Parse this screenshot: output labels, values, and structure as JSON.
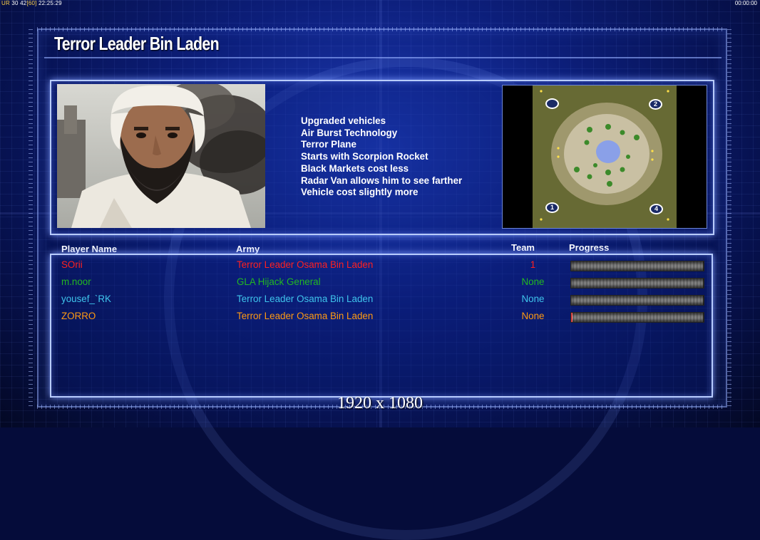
{
  "hud": {
    "left_prefix": "UR",
    "left_stats": "30 42",
    "left_fps": "[60]",
    "left_clock": "22:25:29",
    "right_timer": "00:00:00"
  },
  "title": "Terror Leader Bin Laden",
  "features": [
    "Upgraded vehicles",
    "Air Burst Technology",
    "Terror Plane",
    "Starts with Scorpion Rocket",
    "Black Markets cost less",
    "Radar Van allows him to see farther",
    "Vehicle cost slightly more"
  ],
  "minimap": {
    "start_positions": [
      "",
      "2",
      "1",
      "4"
    ]
  },
  "columns": {
    "player": "Player Name",
    "army": "Army",
    "team": "Team",
    "progress": "Progress"
  },
  "players": [
    {
      "name": "SOrii",
      "army": "Terror Leader Osama Bin Laden",
      "team": "1",
      "color": "#ff2020",
      "progress": 0.0
    },
    {
      "name": "m.noor",
      "army": "GLA Hijack General",
      "team": "None",
      "color": "#22b822",
      "progress": 0.0
    },
    {
      "name": "yousef_`RK",
      "army": "Terror Leader Osama Bin Laden",
      "team": "None",
      "color": "#3fc4ec",
      "progress": 0.0
    },
    {
      "name": "ZORRO",
      "army": "Terror Leader Osama Bin Laden",
      "team": "None",
      "color": "#ff9a12",
      "progress": 0.01
    }
  ],
  "resolution_label": "1920 x 1080"
}
